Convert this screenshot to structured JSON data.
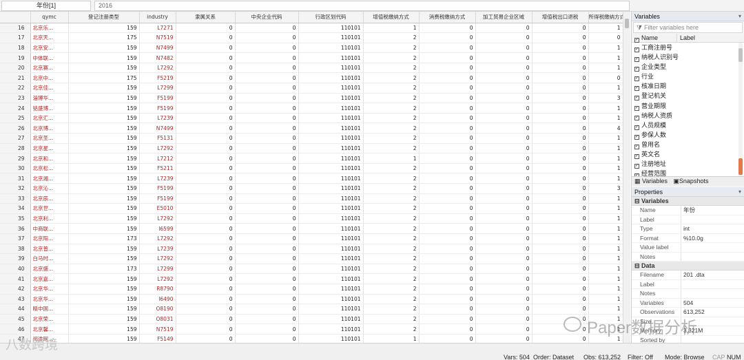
{
  "cellbar": {
    "ref": "年份[1]",
    "value": "2016"
  },
  "columns": [
    "qymc",
    "登记注册类型",
    "industry",
    "隶属关系",
    "中央企业代码",
    "行政区划代码",
    "增值税缴纳方式",
    "消费税缴纳方式",
    "加工贸易企业区域",
    "增值税出口退税",
    "所得税缴纳方式"
  ],
  "rows": [
    [
      "16",
      "北京乐...",
      "159",
      "L7271",
      "0",
      "0",
      "110101",
      "1",
      "0",
      "0",
      "0",
      "1"
    ],
    [
      "17",
      "北京天...",
      "175",
      "N7519",
      "0",
      "0",
      "110101",
      "2",
      "0",
      "0",
      "0",
      "0"
    ],
    [
      "18",
      "北京安...",
      "159",
      "N7499",
      "0",
      "0",
      "110101",
      "2",
      "0",
      "0",
      "0",
      "1"
    ],
    [
      "19",
      "中体联...",
      "159",
      "N7482",
      "0",
      "0",
      "110101",
      "2",
      "0",
      "0",
      "0",
      "1"
    ],
    [
      "20",
      "北京赛...",
      "159",
      "L7292",
      "0",
      "0",
      "110101",
      "2",
      "0",
      "0",
      "0",
      "1"
    ],
    [
      "21",
      "北京中...",
      "175",
      "F5219",
      "0",
      "0",
      "110101",
      "2",
      "0",
      "0",
      "0",
      "0"
    ],
    [
      "22",
      "北京佳...",
      "159",
      "L7299",
      "0",
      "0",
      "110101",
      "2",
      "0",
      "0",
      "0",
      "1"
    ],
    [
      "23",
      "淄博华...",
      "159",
      "F5199",
      "0",
      "0",
      "110101",
      "2",
      "0",
      "0",
      "0",
      "3"
    ],
    [
      "24",
      "铭盛博...",
      "159",
      "F5199",
      "0",
      "0",
      "110101",
      "2",
      "0",
      "0",
      "0",
      "1"
    ],
    [
      "25",
      "北京汇...",
      "159",
      "L7239",
      "0",
      "0",
      "110101",
      "2",
      "0",
      "0",
      "0",
      "1"
    ],
    [
      "26",
      "北京博...",
      "159",
      "N7499",
      "0",
      "0",
      "110101",
      "2",
      "0",
      "0",
      "0",
      "4"
    ],
    [
      "27",
      "北京圣...",
      "159",
      "F5131",
      "0",
      "0",
      "110101",
      "2",
      "0",
      "0",
      "0",
      "1"
    ],
    [
      "28",
      "北京星...",
      "159",
      "L7292",
      "0",
      "0",
      "110101",
      "2",
      "0",
      "0",
      "0",
      "1"
    ],
    [
      "29",
      "北京和...",
      "159",
      "L7212",
      "0",
      "0",
      "110101",
      "1",
      "0",
      "0",
      "0",
      "1"
    ],
    [
      "30",
      "北京松...",
      "159",
      "F5211",
      "0",
      "0",
      "110101",
      "2",
      "0",
      "0",
      "0",
      "1"
    ],
    [
      "31",
      "北京湘...",
      "159",
      "L7239",
      "0",
      "0",
      "110101",
      "2",
      "0",
      "0",
      "0",
      "1"
    ],
    [
      "32",
      "北京沁...",
      "159",
      "F5199",
      "0",
      "0",
      "110101",
      "2",
      "0",
      "0",
      "0",
      "3"
    ],
    [
      "33",
      "北京辰...",
      "159",
      "F5199",
      "0",
      "0",
      "110101",
      "2",
      "0",
      "0",
      "0",
      "1"
    ],
    [
      "34",
      "北京世...",
      "159",
      "E5010",
      "0",
      "0",
      "110101",
      "2",
      "0",
      "0",
      "0",
      "1"
    ],
    [
      "35",
      "北京利...",
      "159",
      "L7292",
      "0",
      "0",
      "110101",
      "2",
      "0",
      "0",
      "0",
      "1"
    ],
    [
      "36",
      "中商联...",
      "159",
      "I6599",
      "0",
      "0",
      "110101",
      "2",
      "0",
      "0",
      "0",
      "1"
    ],
    [
      "37",
      "北京阳...",
      "173",
      "L7292",
      "0",
      "0",
      "110101",
      "2",
      "0",
      "0",
      "0",
      "1"
    ],
    [
      "38",
      "北京普...",
      "159",
      "L7239",
      "0",
      "0",
      "110101",
      "2",
      "0",
      "0",
      "0",
      "1"
    ],
    [
      "39",
      "白马时...",
      "159",
      "L7292",
      "0",
      "0",
      "110101",
      "2",
      "0",
      "0",
      "0",
      "1"
    ],
    [
      "40",
      "北京盛...",
      "173",
      "L7299",
      "0",
      "0",
      "110101",
      "2",
      "0",
      "0",
      "0",
      "1"
    ],
    [
      "41",
      "北京嘉...",
      "159",
      "L7292",
      "0",
      "0",
      "110101",
      "2",
      "0",
      "0",
      "0",
      "1"
    ],
    [
      "42",
      "北京华...",
      "159",
      "R8790",
      "0",
      "0",
      "110101",
      "2",
      "0",
      "0",
      "0",
      "1"
    ],
    [
      "43",
      "北京华...",
      "159",
      "I6490",
      "0",
      "0",
      "110101",
      "2",
      "0",
      "0",
      "0",
      "1"
    ],
    [
      "44",
      "精中国...",
      "159",
      "O8190",
      "0",
      "0",
      "110101",
      "2",
      "0",
      "0",
      "0",
      "1"
    ],
    [
      "45",
      "北京荣...",
      "159",
      "O8031",
      "0",
      "0",
      "110101",
      "2",
      "0",
      "0",
      "0",
      "1"
    ],
    [
      "46",
      "北京馨...",
      "159",
      "N7519",
      "0",
      "0",
      "110101",
      "2",
      "0",
      "0",
      "0",
      "1"
    ],
    [
      "47",
      "阅途网...",
      "159",
      "F5149",
      "0",
      "0",
      "110101",
      "1",
      "0",
      "0",
      "0",
      "1"
    ]
  ],
  "variables_panel": {
    "title": "Variables",
    "filter_placeholder": "Filter variables here",
    "col_name": "Name",
    "col_label": "Label",
    "items": [
      "工商注册号",
      "纳税人识别号",
      "企业类型",
      "行业",
      "核准日期",
      "登记机关",
      "营业期限",
      "纳税人资质",
      "人员规模",
      "参保人数",
      "曾用名",
      "英文名",
      "注册地址",
      "经营范围"
    ],
    "tab_variables": "Variables",
    "tab_snapshots": "Snapshots"
  },
  "properties_panel": {
    "title": "Properties",
    "variables_section": "Variables",
    "var_props": [
      [
        "Name",
        "年份"
      ],
      [
        "Label",
        ""
      ],
      [
        "Type",
        "int"
      ],
      [
        "Format",
        "%10.0g"
      ],
      [
        "Value label",
        ""
      ],
      [
        "Notes",
        ""
      ]
    ],
    "data_section": "Data",
    "data_props": [
      [
        "Filename",
        "201 .dta"
      ],
      [
        "Label",
        ""
      ],
      [
        "Notes",
        ""
      ],
      [
        "Variables",
        "504"
      ],
      [
        "Observations",
        "613,252"
      ],
      [
        "Size",
        ""
      ],
      [
        "Memory",
        "3,321M"
      ],
      [
        "Sorted by",
        ""
      ]
    ]
  },
  "status": {
    "vars": "Vars: 504",
    "order": "Order: Dataset",
    "obs": "Obs: 613,252",
    "filter": "Filter: Off",
    "mode": "Mode: Browse",
    "cap": "CAP",
    "num": "NUM"
  },
  "watermarks": {
    "right": "Paper数据分析",
    "left": "八数跨境"
  },
  "colors": {
    "string_cell": "#b02424",
    "header_bg": "#f4f4f4",
    "panel_title_bg": "#e6ebf1"
  }
}
